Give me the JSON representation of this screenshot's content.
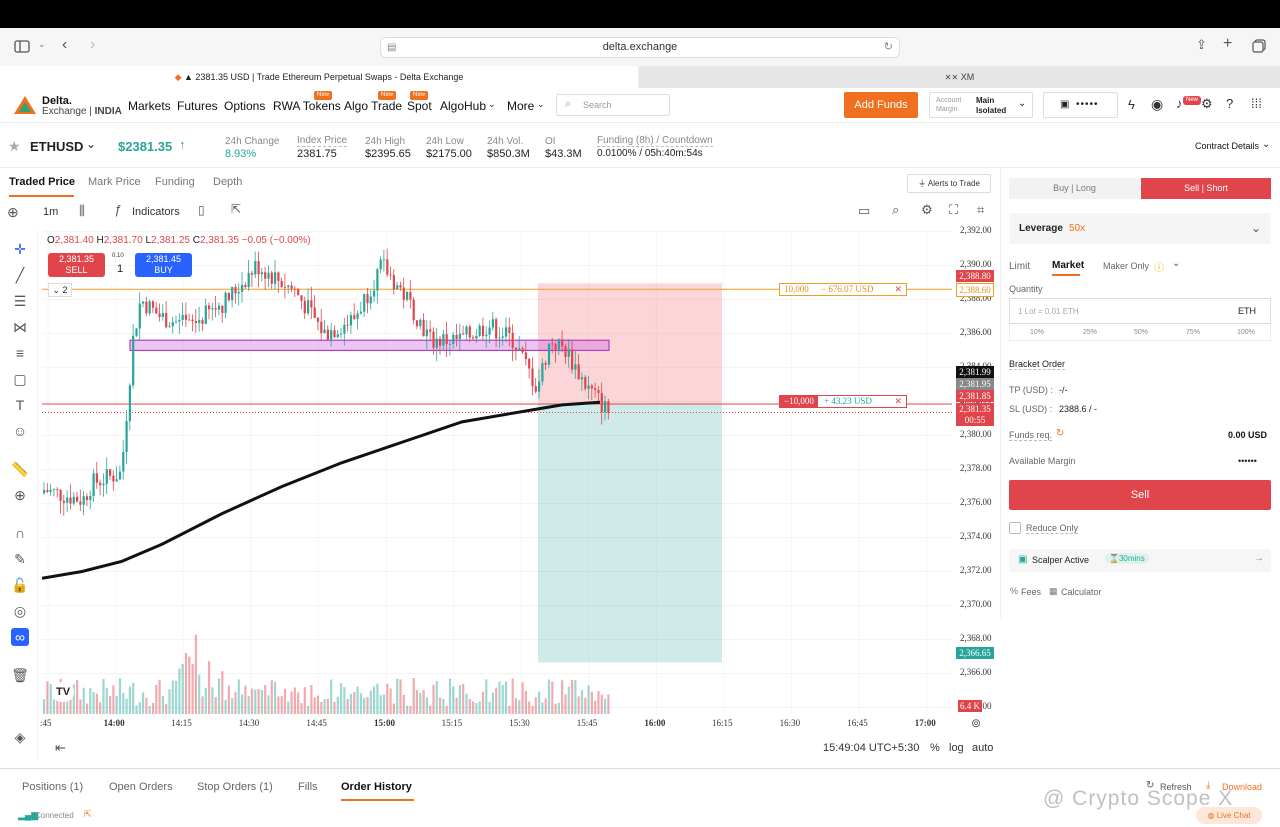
{
  "browser": {
    "url": "delta.exchange",
    "tab1": "▲ 2381.35 USD | Trade Ethereum Perpetual Swaps - Delta Exchange",
    "tab2": "XM"
  },
  "brand": {
    "line1": "Delta.",
    "line2": "Exchange",
    "region": "INDIA",
    "accent": "#f07020"
  },
  "nav": {
    "items": [
      "Markets",
      "Futures",
      "Options",
      "RWA Tokens",
      "Algo Trade",
      "Spot",
      "AlgoHub",
      "More"
    ],
    "new_badge": "New",
    "search_placeholder": "Search",
    "add_funds": "Add Funds",
    "account_margin_label_1": "Account",
    "account_margin_label_2": "Margin",
    "account_margin_value_1": "Main",
    "account_margin_value_2": "Isolated",
    "balance_masked": "•••••"
  },
  "ticker": {
    "symbol": "ETHUSD",
    "price": "$2381.35",
    "change_label": "24h Change",
    "change_value": "8.93%",
    "index_label": "Index Price",
    "index_value": "2381.75",
    "high_label": "24h High",
    "high_value": "$2395.65",
    "low_label": "24h Low",
    "low_value": "$2175.00",
    "vol_label": "24h Vol.",
    "vol_value": "$850.3M",
    "oi_label": "OI",
    "oi_value": "$43.3M",
    "funding_label": "Funding (8h) / Countdown",
    "funding_value": "0.0100% / 05h:40m:54s",
    "contract_details": "Contract Details"
  },
  "chart_tabs": [
    "Traded Price",
    "Mark Price",
    "Funding",
    "Depth"
  ],
  "alerts_to_trade": "Alerts to Trade",
  "toolbar": {
    "interval": "1m",
    "indicators": "Indicators"
  },
  "ohlc": {
    "o_label": "O",
    "o": "2,381.40",
    "h_label": "H",
    "h": "2,381.70",
    "l_label": "L",
    "l": "2,381.25",
    "c_label": "C",
    "c": "2,381.35",
    "change": "−0.05 (−0.00%)"
  },
  "quick_trade": {
    "sell_price": "2,381.35",
    "sell": "SELL",
    "qty": "1",
    "qty_step": "0.10",
    "buy_price": "2,381.45",
    "buy": "BUY",
    "collapse": "2"
  },
  "chart_data": {
    "type": "candlestick",
    "x_ticks": [
      ":45",
      "14:00",
      "14:15",
      "14:30",
      "14:45",
      "15:00",
      "15:15",
      "15:30",
      "15:45",
      "16:00",
      "16:15",
      "16:30",
      "16:45",
      "17:00"
    ],
    "y_ticks": [
      "2,392.00",
      "2,390.00",
      "2,388.00",
      "2,386.00",
      "2,384.00",
      "2,382.00",
      "2,380.00",
      "2,378.00",
      "2,376.00",
      "2,374.00",
      "2,372.00",
      "2,370.00",
      "2,368.00",
      "2,366.00",
      "2,364.00"
    ],
    "ylim": [
      2363.5,
      2392.2
    ],
    "price_labels": {
      "tp_order": "2,388.80",
      "tp_order2": "2,388.60",
      "last1": "2,381.99",
      "last2": "2,381.95",
      "last3": "2,381.85",
      "current": "2,381.35",
      "countdown": "00:55",
      "target": "2,366.65",
      "volume": "6.4 K"
    },
    "order_tag_top": {
      "qty": "10,000",
      "pnl": "− 676.07 USD"
    },
    "order_tag_pos": {
      "qty": "−10,000",
      "pnl": "+ 43.23 USD"
    },
    "close_glyph": "✕"
  },
  "footer": {
    "time": "15:49:04 UTC+5:30",
    "pct": "%",
    "log": "log",
    "auto": "auto"
  },
  "order": {
    "buy_tab": "Buy | Long",
    "sell_tab": "Sell | Short",
    "leverage_label": "Leverage",
    "leverage_value": "50x",
    "types": [
      "Limit",
      "Market",
      "Maker Only"
    ],
    "quantity_label": "Quantity",
    "quantity_placeholder": "1 Lot = 0.01 ETH",
    "quantity_unit": "ETH",
    "pcts": [
      "10%",
      "25%",
      "50%",
      "75%",
      "100%"
    ],
    "bracket": "Bracket Order",
    "tp_label": "TP (USD) :",
    "tp_value": "-/-",
    "sl_label": "SL (USD) :",
    "sl_value": "2388.6 / -",
    "funds_label": "Funds req.",
    "funds_value": "0.00  USD",
    "avail_label": "Available Margin",
    "avail_value": "••••••",
    "sell_button": "Sell",
    "reduce_only": "Reduce Only",
    "scalper": "Scalper Active",
    "scalper_time": "30mins",
    "fees": "Fees",
    "calculator": "Calculator"
  },
  "bottom_tabs": [
    "Positions (1)",
    "Open Orders",
    "Stop Orders (1)",
    "Fills",
    "Order History"
  ],
  "bottom_right": {
    "refresh": "Refresh",
    "download": "Download",
    "live_chat": "Live Chat"
  },
  "status": {
    "connected": "Connected"
  },
  "watermark": "@ Crypto Scope X",
  "colors": {
    "green": "#26a69a",
    "red": "#e0454b",
    "orange": "#f07020",
    "ema": "#111111"
  }
}
